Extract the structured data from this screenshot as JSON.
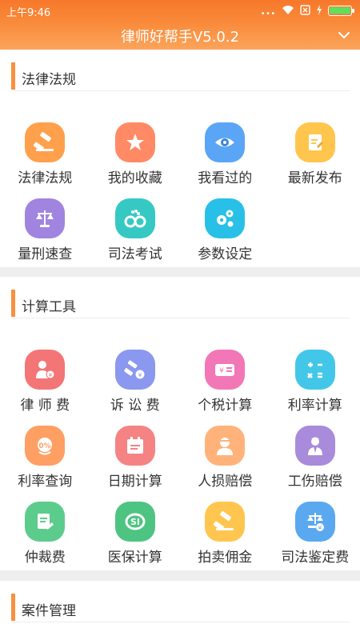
{
  "status": {
    "time": "上午9:46",
    "dots": "..."
  },
  "app": {
    "title": "律师好帮手V5.0.2"
  },
  "sections": [
    {
      "title": "法律法规",
      "items": [
        {
          "label": "法律法规",
          "icon": "gavel-icon",
          "color": "#ffa04c"
        },
        {
          "label": "我的收藏",
          "icon": "star-icon",
          "color": "#ff8a65"
        },
        {
          "label": "我看过的",
          "icon": "eye-icon",
          "color": "#5aa5f5"
        },
        {
          "label": "最新发布",
          "icon": "document-icon",
          "color": "#ffc54d"
        },
        {
          "label": "量刑速查",
          "icon": "scales-icon",
          "color": "#a084e0"
        },
        {
          "label": "司法考试",
          "icon": "handcuffs-icon",
          "color": "#36c9c4"
        },
        {
          "label": "参数设定",
          "icon": "gears-icon",
          "color": "#29c0e8"
        }
      ]
    },
    {
      "title": "计算工具",
      "items": [
        {
          "label": "律 师 费",
          "icon": "lawyer-fee-icon",
          "color": "#f47575"
        },
        {
          "label": "诉 讼 费",
          "icon": "litigation-fee-icon",
          "color": "#8a98ef"
        },
        {
          "label": "个税计算",
          "icon": "tax-icon",
          "color": "#f277b6"
        },
        {
          "label": "利率计算",
          "icon": "calculator-icon",
          "color": "#43c7e8"
        },
        {
          "label": "利率查询",
          "icon": "percent-icon",
          "color": "#ff9f63"
        },
        {
          "label": "日期计算",
          "icon": "calendar-icon",
          "color": "#f58383"
        },
        {
          "label": "人损赔偿",
          "icon": "injured-person-icon",
          "color": "#ffb37a"
        },
        {
          "label": "工伤赔偿",
          "icon": "worker-icon",
          "color": "#a98bdb"
        },
        {
          "label": "仲裁费",
          "icon": "arbitration-icon",
          "color": "#5ccc8d"
        },
        {
          "label": "医保计算",
          "icon": "medical-insurance-icon",
          "color": "#4dc481"
        },
        {
          "label": "拍卖佣金",
          "icon": "auction-hammer-icon",
          "color": "#ffc64f"
        },
        {
          "label": "司法鉴定费",
          "icon": "judicial-appraisal-icon",
          "color": "#5aa8f0"
        }
      ]
    },
    {
      "title": "案件管理",
      "items": []
    }
  ]
}
